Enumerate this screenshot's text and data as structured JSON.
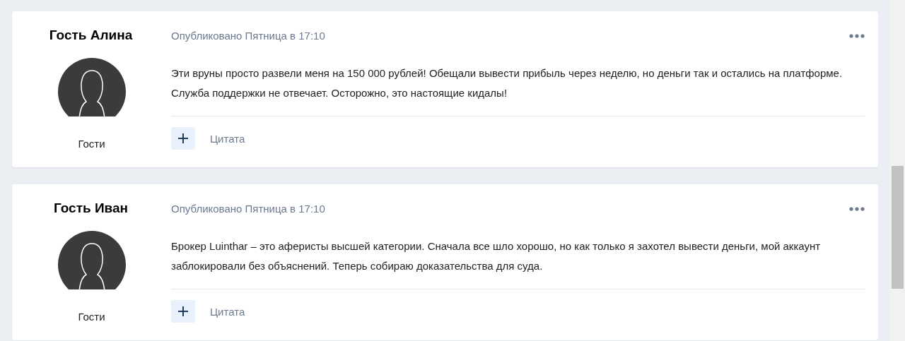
{
  "posts": [
    {
      "author": "Гость Алина",
      "role": "Гости",
      "meta": "Опубликовано Пятница в 17:10",
      "text": "Эти вруны просто развели меня на 150 000 рублей! Обещали вывести прибыль через неделю, но деньги так и остались на платформе. Служба поддержки не отвечает. Осторожно, это настоящие кидалы!",
      "quote": "Цитата"
    },
    {
      "author": "Гость Иван",
      "role": "Гости",
      "meta": "Опубликовано Пятница в 17:10",
      "text": "Брокер Luinthar – это аферисты высшей категории. Сначала все шло хорошо, но как только я захотел вывести деньги, мой аккаунт заблокировали без объяснений. Теперь собираю доказательства для суда.",
      "quote": "Цитата"
    }
  ]
}
